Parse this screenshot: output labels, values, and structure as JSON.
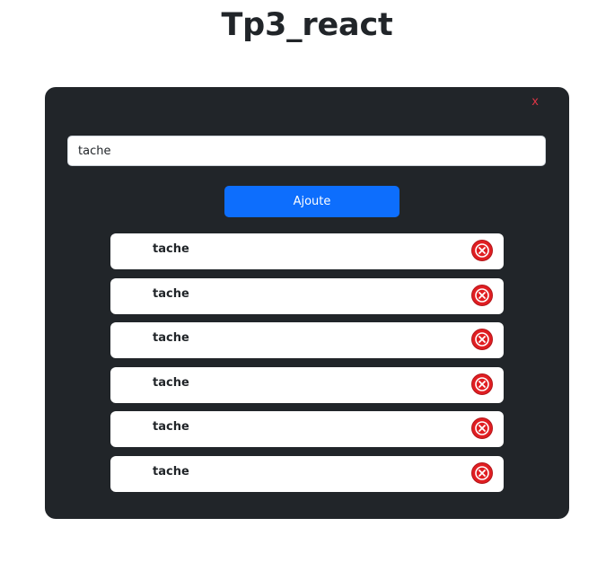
{
  "header": {
    "title": "Tp3_react"
  },
  "card": {
    "close_label": "x",
    "input": {
      "value": "tache",
      "placeholder": ""
    },
    "add_button_label": "Ajoute",
    "tasks": [
      {
        "text": "tache"
      },
      {
        "text": "tache"
      },
      {
        "text": "tache"
      },
      {
        "text": "tache"
      },
      {
        "text": "tache"
      },
      {
        "text": "tache"
      }
    ]
  },
  "colors": {
    "card_background": "#212529",
    "primary": "#0d6efd",
    "danger": "#dc3545",
    "delete_icon": "#e01e22"
  },
  "icons": {
    "delete": "circle-x-icon"
  }
}
